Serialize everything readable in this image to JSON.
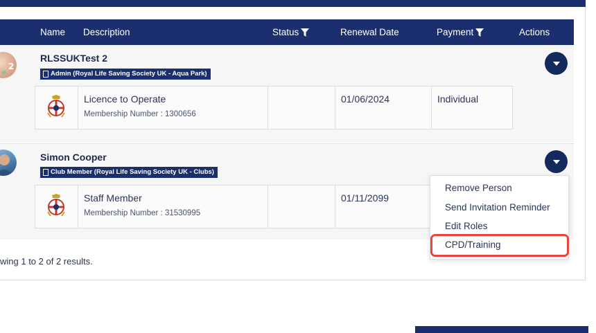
{
  "table": {
    "columns": {
      "name": "Name",
      "description": "Description",
      "status": "Status",
      "renewal_date": "Renewal Date",
      "payment": "Payment",
      "actions": "Actions"
    }
  },
  "members": [
    {
      "name": "RLSSUKTest 2",
      "role_badge": "Admin (Royal Life Saving Society UK - Aqua Park)",
      "membership": {
        "title": "Licence to Operate",
        "number": "Membership Number : 1300656",
        "status": "",
        "renewal_date": "01/06/2024",
        "payment": "Individual"
      }
    },
    {
      "name": "Simon Cooper",
      "role_badge": "Club Member (Royal Life Saving Society UK - Clubs)",
      "membership": {
        "title": "Staff Member",
        "number": "Membership Number : 31530995",
        "status": "",
        "renewal_date": "01/11/2099",
        "payment": ""
      }
    }
  ],
  "actions_menu": {
    "items": [
      "Remove Person",
      "Send Invitation Reminder",
      "Edit Roles",
      "CPD/Training"
    ],
    "highlighted": "CPD/Training"
  },
  "footer": {
    "results_text": "wing 1 to 2 of 2 results."
  },
  "colors": {
    "navy": "#1b2f6e",
    "action_button": "#142a5c",
    "highlight": "#e8453c",
    "row_bg": "#f6f6f7"
  }
}
